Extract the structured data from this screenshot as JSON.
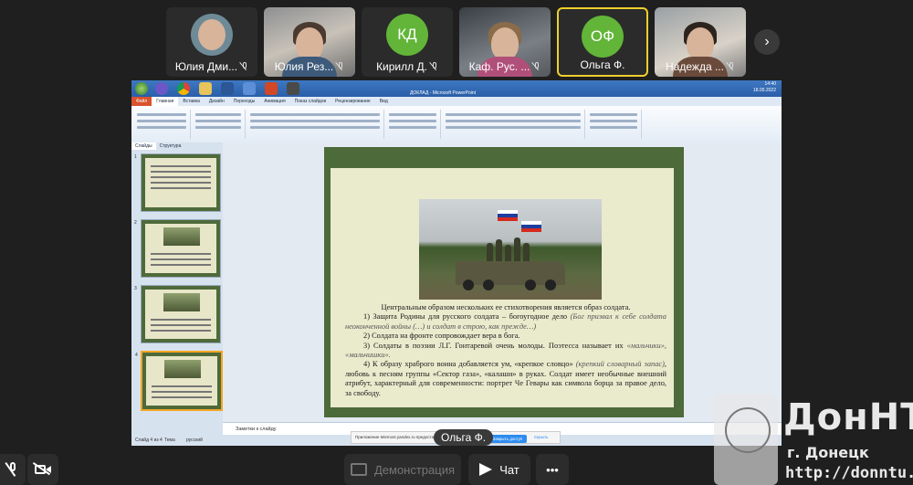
{
  "participants": [
    {
      "name": "Юлия Дми...",
      "type": "photo",
      "muted": true
    },
    {
      "name": "Юлия Рез...",
      "type": "photo",
      "muted": true
    },
    {
      "name": "Кирилл Д.",
      "initials": "КД",
      "color": "#62b538",
      "muted": true
    },
    {
      "name": "Каф. Рус. ...",
      "type": "photo",
      "muted": true
    },
    {
      "name": "Ольга Ф.",
      "initials": "ОФ",
      "color": "#62b538",
      "active": true
    },
    {
      "name": "Надежда ...",
      "type": "photo",
      "muted": true
    }
  ],
  "next_icon": "chevron-right-icon",
  "screen": {
    "window_title": "ДОКЛАД - Microsoft PowerPoint",
    "clock": "14:40",
    "date": "18.05.2022",
    "ribbon_tabs": [
      "Файл",
      "Главная",
      "Вставка",
      "Дизайн",
      "Переходы",
      "Анимация",
      "Показ слайдов",
      "Рецензирование",
      "Вид"
    ],
    "side_tabs": [
      "Слайды",
      "Структура"
    ],
    "thumb_numbers": [
      "1",
      "2",
      "3",
      "4"
    ],
    "notes_placeholder": "Заметки к слайду",
    "status_left": "Слайд 4 из 4",
    "status_theme": "Тема",
    "status_lang": "русский",
    "share_note": "Приложение telemost.yandex.ru предоставило доступ к экрану.",
    "share_stop": "Закрыть доступ",
    "share_hide": "Скрыть"
  },
  "slide": {
    "intro": "Центральным образом нескольких ее стихотворения является образ солдата.",
    "p1_main": "1) Защита Родины для русского солдата – богоугодное дело",
    "p1_quote": "(Бог призвал к себе солдата неоконченной войны (…) и солдат в строю, как прежде…)",
    "p2": "2) Солдата на фронте сопровождает вера в бога.",
    "p3_main": "3) Солдаты в поэзии Л.Г. Гонтаревой очень молоды. Поэтесса называет их",
    "p3_quote": "«мальчики», «мальчишки».",
    "p4_a": "4) К образу храброго воина добавляется ум, «крепкое словцо»",
    "p4_quote": "(крепкий словарный запас)",
    "p4_b": ", любовь к песням группы «Сектор газа», «калаши» в руках. Солдат имеет необычные внешний атрибут, характерный для современности: портрет Че Гевары как символа борца за правое дело, за свободу."
  },
  "speaker_label": "Ольга Ф.",
  "watermark": {
    "title": "ДонНТУ",
    "city": "г. Донецк",
    "url": "http://donntu.ru"
  },
  "controls": {
    "present": "Демонстрация",
    "chat": "Чат",
    "more": "•••"
  }
}
